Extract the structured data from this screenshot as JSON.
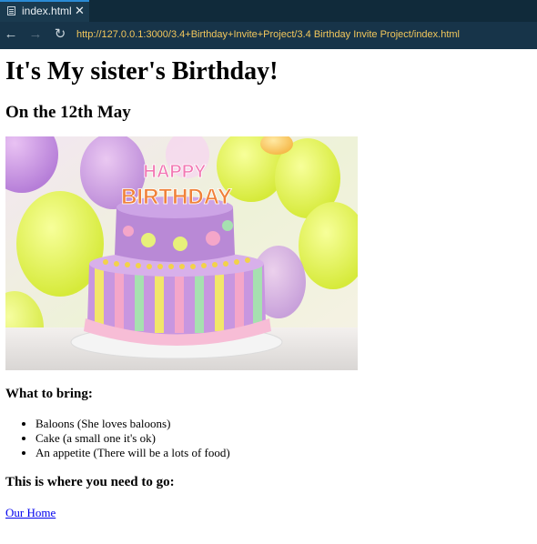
{
  "tab": {
    "title": "index.html",
    "close_glyph": "✕",
    "icon": "file-icon"
  },
  "nav": {
    "back_glyph": "←",
    "forward_glyph": "→",
    "reload_glyph": "↻",
    "url": "http://127.0.0.1:3000/3.4+Birthday+Invite+Project/3.4 Birthday Invite Project/index.html"
  },
  "page": {
    "heading": "It's My sister's Birthday!",
    "subheading": "On the 12th May",
    "image_alt": "birthday-cake-photo",
    "bring_heading": "What to bring:",
    "bring_items": [
      "Baloons (She loves baloons)",
      "Cake (a small one it's ok)",
      "An appetite (There will be a lots of food)"
    ],
    "go_heading": "This is where you need to go:",
    "link_text": "Our Home",
    "cake_text": {
      "top": "HAPPY",
      "bottom": "BIRTHDAY"
    }
  },
  "colors": {
    "chrome_dark": "#102a3a",
    "chrome_nav": "#173449",
    "url_text": "#f2c75c",
    "link": "#0000ee"
  }
}
